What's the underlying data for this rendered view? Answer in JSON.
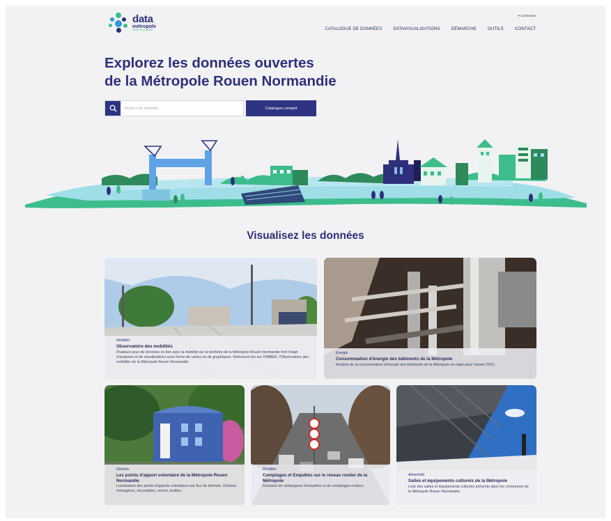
{
  "header": {
    "logo": {
      "line1": "data",
      "line2": "métropole",
      "line3": "Rouen Normandie"
    },
    "login_label": "⇥ Connexion",
    "nav": [
      {
        "label": "CATALOGUE DE DONNÉES"
      },
      {
        "label": "DATAVISUALISATIONS"
      },
      {
        "label": "DÉMARCHE"
      },
      {
        "label": "OUTILS"
      },
      {
        "label": "CONTACT"
      }
    ]
  },
  "hero": {
    "title_line1": "Explorez les données ouvertes",
    "title_line2": "de la Métropole Rouen Normandie",
    "search_placeholder": "XX jeux de données",
    "catalog_button": "Catalogue complet"
  },
  "section": {
    "title": "Visualisez les données",
    "cards": [
      {
        "category": "Mobilités",
        "title": "Observatoire des mobilités",
        "description": "Plusieurs jeux de données en lien avec la mobilité sur le territoire de la Métropole Rouen Normandie font l'objet d'analyses et de visualisations sous forme de cartes ou de graphiques. Retrouvez-les sur OMMER, l'Observatoire des mobilités de la Métropole Rouen Normandie."
      },
      {
        "category": "Énergie",
        "title": "Consommation d'énergie des bâtiments de la Métropole",
        "description": "Analyse de la consommation d'énergie des bâtiments de la Métropole en régie pour l'année 2021."
      },
      {
        "category": "Déchets",
        "title": "Les points d'apport volontaire de la Métropole Rouen Normandie",
        "description": "Localisation des points d'apports volontaires par flux de déchets. Ordures ménagères, recyclables, verres, textiles."
      },
      {
        "category": "Mobilités",
        "title": "Comptages et Enquêtes sur le réseau routier de la Métropole",
        "description": "Données de campagnes d'enquêtes et de comptages routiers."
      },
      {
        "category": "Attractivité",
        "title": "Salles et équipements culturels de la Métropole",
        "description": "Liste des salles et équipements culturels présents dans les communes de la Métropole Rouen Normandie."
      }
    ]
  },
  "colors": {
    "brand": "#2e2f7a",
    "button": "#2e3482",
    "green": "#3dbd8c",
    "background": "#f2f2f4"
  }
}
